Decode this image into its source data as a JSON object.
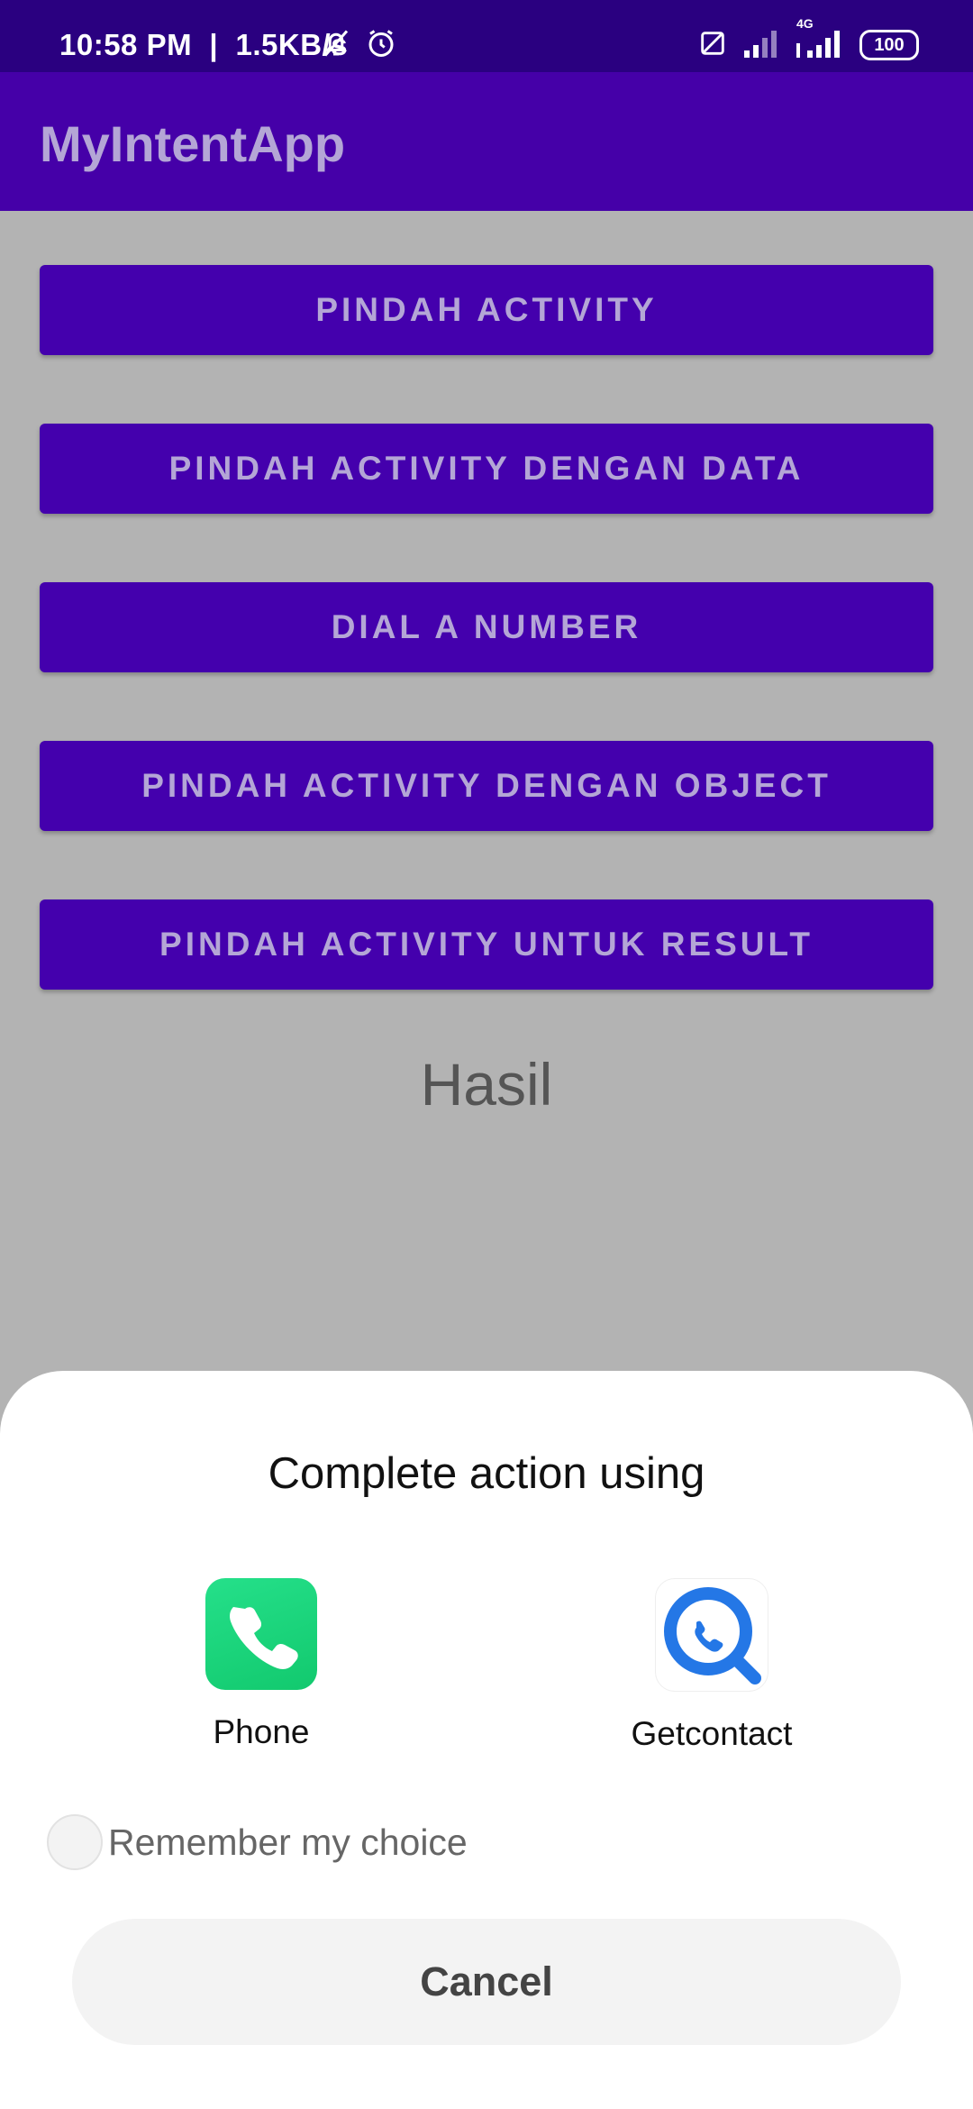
{
  "status_bar": {
    "time": "10:58 PM",
    "net_speed": "1.5KB/s",
    "network_type": "4G",
    "battery": "100"
  },
  "app_bar": {
    "title": "MyIntentApp"
  },
  "buttons": [
    {
      "label": "PINDAH ACTIVITY"
    },
    {
      "label": "PINDAH ACTIVITY DENGAN DATA"
    },
    {
      "label": "DIAL A NUMBER"
    },
    {
      "label": "PINDAH ACTIVITY DENGAN OBJECT"
    },
    {
      "label": "PINDAH ACTIVITY UNTUK RESULT"
    }
  ],
  "result_text": "Hasil",
  "chooser": {
    "title": "Complete action using",
    "apps": [
      {
        "label": "Phone",
        "icon": "phone-app-icon",
        "color": "#1ed67c"
      },
      {
        "label": "Getcontact",
        "icon": "getcontact-app-icon",
        "color": "#2477e6"
      }
    ],
    "remember_label": "Remember my choice",
    "remember_checked": false,
    "cancel_label": "Cancel"
  },
  "colors": {
    "status_bar": "#2a0080",
    "app_bar": "#4500a8",
    "button": "#4400ad",
    "scrim": "#b3b3b3"
  }
}
